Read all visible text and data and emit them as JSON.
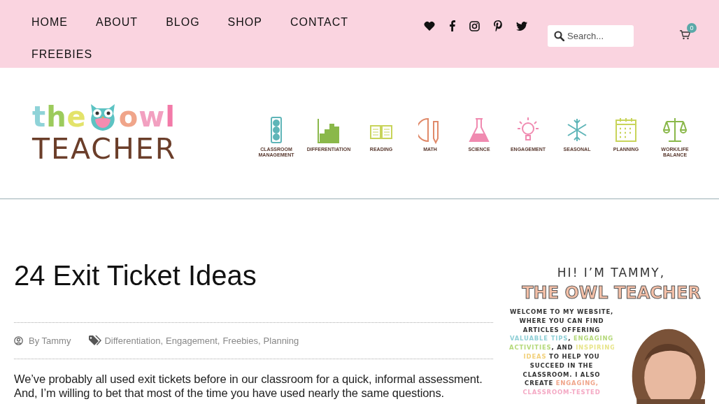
{
  "nav": {
    "items": [
      {
        "label": "HOME"
      },
      {
        "label": "ABOUT"
      },
      {
        "label": "BLOG"
      },
      {
        "label": "SHOP"
      },
      {
        "label": "CONTACT"
      },
      {
        "label": "FREEBIES"
      }
    ],
    "search": {
      "placeholder": "Search..."
    },
    "cart": {
      "count": "0"
    }
  },
  "logo": {
    "top_left": "the",
    "top_right": "owl",
    "bottom": "TEACHER"
  },
  "categories": [
    {
      "label": "CLASSROOM MANAGEMENT"
    },
    {
      "label": "DIFFERENTIATION"
    },
    {
      "label": "READING"
    },
    {
      "label": "MATH"
    },
    {
      "label": "SCIENCE"
    },
    {
      "label": "ENGAGEMENT"
    },
    {
      "label": "SEASONAL"
    },
    {
      "label": "PLANNING"
    },
    {
      "label": "WORK/LIFE BALANCE"
    }
  ],
  "article": {
    "title": "24 Exit Ticket Ideas",
    "author": "By Tammy",
    "tags": [
      "Differentiation",
      "Engagement",
      "Freebies",
      "Planning"
    ],
    "tag_separator": ",",
    "body": "We’ve probably all used exit tickets before in our classroom for a quick, informal assessment. And, I’m willing to bet that most of the time you have used nearly the same questions."
  },
  "sidebar": {
    "greeting": "HI! I’M TAMMY,",
    "headline": "THE OWL TEACHER",
    "intro": [
      "WELCOME TO MY WEBSITE,",
      "WHERE YOU CAN FIND",
      "ARTICLES OFFERING"
    ],
    "highlights": [
      {
        "text": "VALUABLE TIPS",
        "color": "#8fcfd6"
      },
      {
        "text": ", "
      },
      {
        "text": "ENGAGING",
        "color": "#b5d97a"
      },
      {
        "text": "ACTIVITIES",
        "color": "#b5d97a"
      },
      {
        "text": ", AND "
      },
      {
        "text": "INSPIRING",
        "color": "#e8e58a"
      },
      {
        "text": "IDEAS",
        "color": "#f2d07a"
      },
      {
        "text": " TO HELP YOU"
      }
    ],
    "outro": [
      "SUCCEED IN THE",
      "CLASSROOM. I ALSO"
    ],
    "last": [
      {
        "text": "CREATE "
      },
      {
        "text": "ENGAGING,",
        "color": "#f0a58a"
      }
    ],
    "cut": {
      "text": "CLASSROOM-TESTED",
      "color": "#f4a9c4"
    },
    "photo": {
      "kind": "picture"
    }
  }
}
